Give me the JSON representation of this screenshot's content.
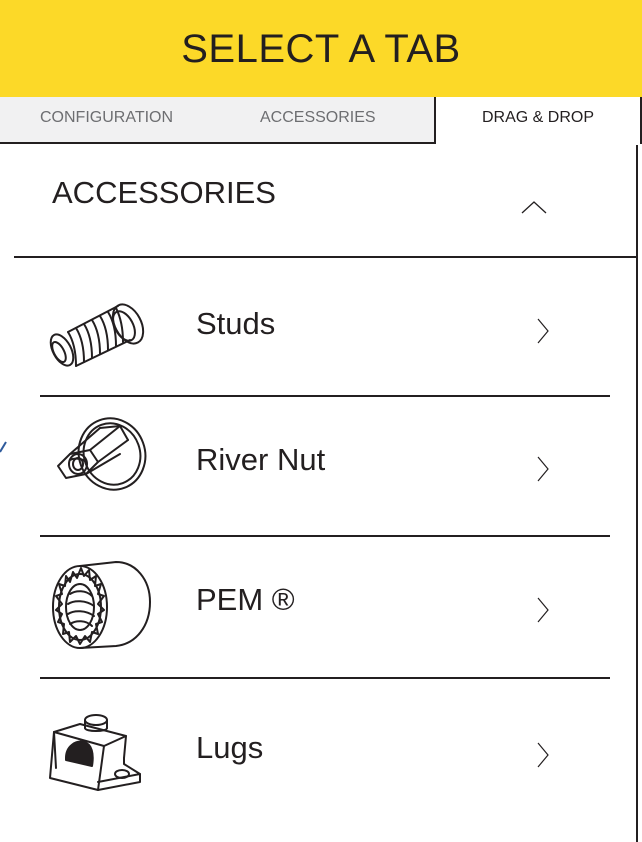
{
  "header": {
    "title": "SELECT A TAB"
  },
  "tabs": [
    {
      "label": "CONFIGURATION",
      "active": false
    },
    {
      "label": "ACCESSORIES",
      "active": false
    },
    {
      "label": "DRAG & DROP",
      "active": true
    }
  ],
  "section": {
    "title": "ACCESSORIES",
    "expanded": true,
    "toggle_icon": "chevron-up-icon"
  },
  "items": [
    {
      "label": "Studs",
      "icon": "stud-icon",
      "arrow": "chevron-right-icon"
    },
    {
      "label": "River Nut",
      "icon": "rivet-nut-icon",
      "arrow": "chevron-right-icon"
    },
    {
      "label": "PEM ®",
      "icon": "pem-nut-icon",
      "arrow": "chevron-right-icon"
    },
    {
      "label": "Lugs",
      "icon": "lug-icon",
      "arrow": "chevron-right-icon"
    }
  ],
  "colors": {
    "header_bg": "#fcd928",
    "tab_strip_bg": "#f1f1f2",
    "text": "#231f20",
    "muted_text": "#6d6e71",
    "edge_accent": "#2f5b9c"
  }
}
